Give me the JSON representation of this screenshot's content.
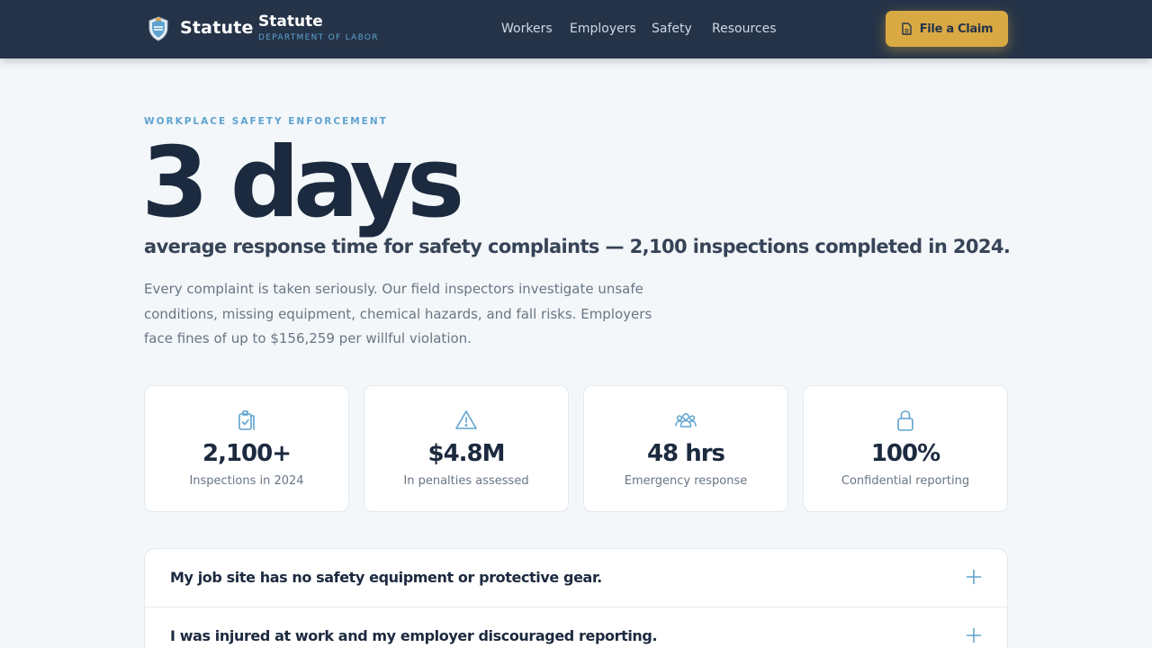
{
  "header": {
    "brand_name": "Statute",
    "brand_title": "Statute",
    "brand_subtitle": "DEPARTMENT OF LABOR",
    "nav": [
      {
        "label": "Workers"
      },
      {
        "label": "Employers"
      },
      {
        "label": "Safety"
      },
      {
        "label": "Resources"
      }
    ],
    "cta_label": "File a Claim",
    "cta_icon": "document-icon",
    "logo_icon": "shield-logo-icon"
  },
  "hero": {
    "eyebrow": "WORKPLACE SAFETY ENFORCEMENT",
    "stat": "3 days",
    "headline": "average response time for safety complaints — 2,100 inspections completed in 2024.",
    "body": "Every complaint is taken seriously. Our field inspectors investigate unsafe conditions, missing equipment, chemical hazards, and fall risks. Employers face fines of up to $156,259 per willful violation."
  },
  "stats": [
    {
      "icon": "clipboard-check-icon",
      "value": "2,100+",
      "label": "Inspections in 2024"
    },
    {
      "icon": "warning-icon",
      "value": "$4.8M",
      "label": "In penalties assessed"
    },
    {
      "icon": "people-icon",
      "value": "48 hrs",
      "label": "Emergency response"
    },
    {
      "icon": "lock-icon",
      "value": "100%",
      "label": "Confidential reporting"
    }
  ],
  "faq": [
    {
      "question": "My job site has no safety equipment or protective gear."
    },
    {
      "question": "I was injured at work and my employer discouraged reporting."
    }
  ],
  "colors": {
    "navy": "#243348",
    "accent_gold": "#d9a944",
    "accent_blue": "#5fa3cf",
    "background": "#f3f7fa"
  }
}
